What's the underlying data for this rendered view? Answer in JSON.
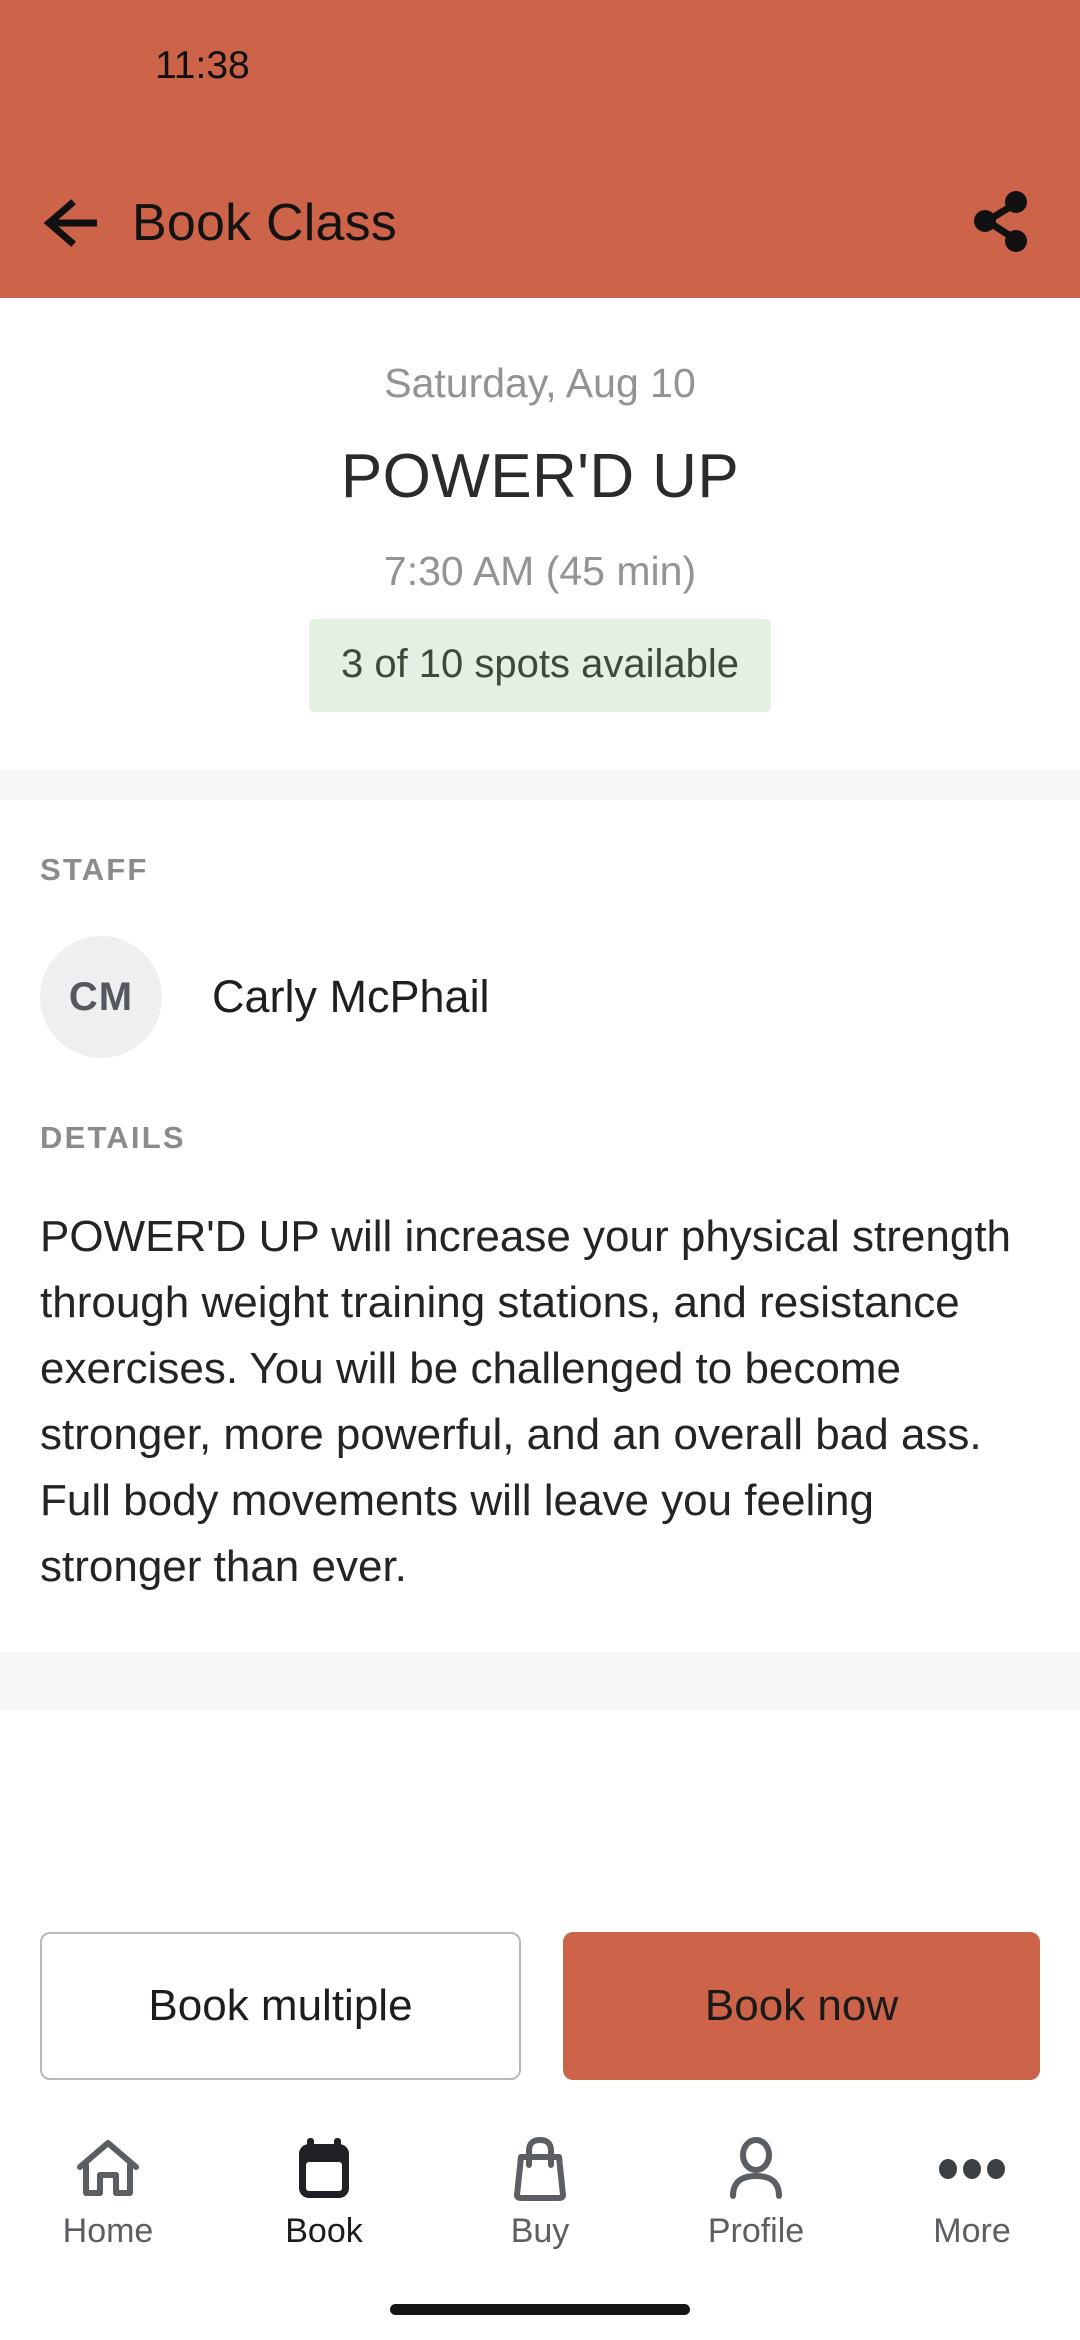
{
  "status_bar": {
    "time": "11:38"
  },
  "app_bar": {
    "title": "Book Class",
    "back_icon": "arrow-left-icon",
    "share_icon": "share-icon",
    "background_color": "#cd6449"
  },
  "class_summary": {
    "date": "Saturday, Aug 10",
    "name": "POWER'D UP",
    "time": "7:30 AM (45 min)",
    "availability": "3 of 10 spots available",
    "availability_bg": "#e4f0e2",
    "availability_text_color": "#3b4b38"
  },
  "staff_section": {
    "label": "STAFF",
    "members": [
      {
        "initials": "CM",
        "name": "Carly McPhail"
      }
    ]
  },
  "details_section": {
    "label": "DETAILS",
    "body": "POWER'D UP will increase your physical strength through weight training stations, and resistance exercises. You will be challenged to become stronger, more powerful, and an overall bad ass. Full body movements will leave you feeling stronger than ever."
  },
  "actions": {
    "secondary_label": "Book multiple",
    "primary_label": "Book now",
    "primary_color": "#cd6449"
  },
  "bottom_nav": {
    "items": [
      {
        "label": "Home",
        "icon": "home-icon",
        "active": false
      },
      {
        "label": "Book",
        "icon": "calendar-icon",
        "active": true
      },
      {
        "label": "Buy",
        "icon": "bag-icon",
        "active": false
      },
      {
        "label": "Profile",
        "icon": "person-icon",
        "active": false
      },
      {
        "label": "More",
        "icon": "ellipsis-icon",
        "active": false
      }
    ]
  }
}
